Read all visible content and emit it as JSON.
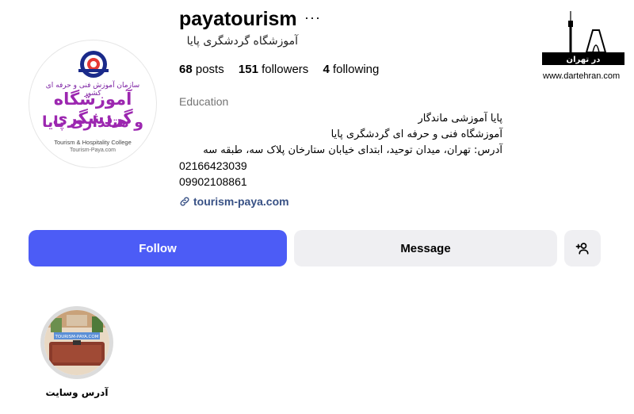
{
  "profile": {
    "username": "payatourism",
    "more_icon": "more-horizontal-icon",
    "full_name": "آموزشگاه گردشگری پایا",
    "stats": {
      "posts_count": "68",
      "posts_label": "posts",
      "followers_count": "151",
      "followers_label": "followers",
      "following_count": "4",
      "following_label": "following"
    },
    "category": "Education",
    "bio_lines": [
      "پایا آموزشی ماندگار",
      "آموزشگاه فنی و حرفه ای گردشگری پایا",
      "آدرس: تهران، میدان توحید، ابتدای خیابان ستارخان پلاک سه، طبقه سه"
    ],
    "phones": [
      "02166423039",
      "09902108861"
    ],
    "website": "tourism-paya.com",
    "link_icon": "link-icon"
  },
  "avatar": {
    "subtitle": "سازمان آموزش فنی و حرفه ای کشور",
    "title_line1": "آموزشگاه گردشگری",
    "title_line2": "و هتلداری پایا",
    "english_name": "Tourism & Hospitality College",
    "english_url": "Tourism-Paya.com"
  },
  "actions": {
    "follow_label": "Follow",
    "message_label": "Message",
    "add_user_icon": "add-user-icon"
  },
  "highlights": [
    {
      "label": "آدرس وسایت",
      "thumb_text": "TOURISM-PAYA.COM"
    }
  ],
  "watermark": {
    "text": "در تهران",
    "url": "www.dartehran.com"
  },
  "colors": {
    "follow_button": "#4c5cf6",
    "secondary_button": "#efeff2",
    "link": "#385185",
    "avatar_title": "#9c27b0"
  }
}
